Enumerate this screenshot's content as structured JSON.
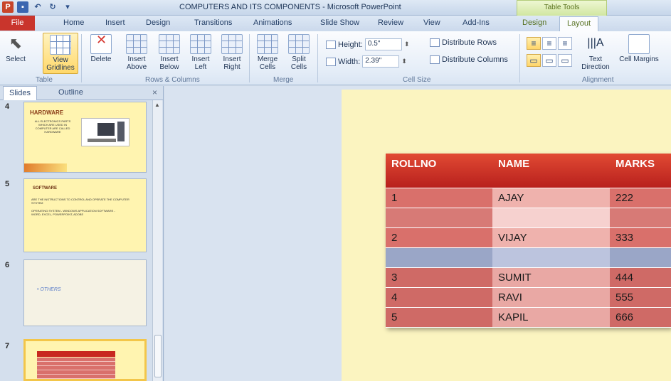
{
  "titlebar": {
    "title": "COMPUTERS AND ITS COMPONENTS  -  Microsoft PowerPoint",
    "contextual_group": "Table Tools"
  },
  "tabs": [
    {
      "label": "File"
    },
    {
      "label": "Home"
    },
    {
      "label": "Insert"
    },
    {
      "label": "Design"
    },
    {
      "label": "Transitions"
    },
    {
      "label": "Animations"
    },
    {
      "label": "Slide Show"
    },
    {
      "label": "Review"
    },
    {
      "label": "View"
    },
    {
      "label": "Add-Ins"
    },
    {
      "label": "Design"
    },
    {
      "label": "Layout"
    }
  ],
  "ribbon": {
    "table_group": {
      "label": "Table",
      "select": "Select",
      "view_gridlines": "View Gridlines"
    },
    "rows_columns": {
      "label": "Rows & Columns",
      "delete": "Delete",
      "insert_above": "Insert Above",
      "insert_below": "Insert Below",
      "insert_left": "Insert Left",
      "insert_right": "Insert Right"
    },
    "merge": {
      "label": "Merge",
      "merge_cells": "Merge Cells",
      "split_cells": "Split Cells"
    },
    "cell_size": {
      "label": "Cell Size",
      "height_label": "Height:",
      "height_value": "0.5\"",
      "width_label": "Width:",
      "width_value": "2.39\"",
      "distribute_rows": "Distribute Rows",
      "distribute_columns": "Distribute Columns"
    },
    "alignment": {
      "label": "Alignment",
      "text_direction": "Text Direction",
      "cell_margins": "Cell Margins"
    }
  },
  "slides_pane": {
    "tab_slides": "Slides",
    "tab_outline": "Outline",
    "close": "×",
    "thumbs": [
      {
        "num": "4",
        "title": "HARDWARE",
        "body": "ALL ELECTRONICS PARTS WHICH ARE USED IN COMPUTER ARE CALLED HARDWARE"
      },
      {
        "num": "5",
        "title": "SOFTWARE",
        "body": "ARE THE INSTRUCTIONS TO CONTROL AND OPERATE THE COMPUTER SYSTEM",
        "body2": "OPERATING SYSTEM - WINDOWS  APPLICATION SOFTWARE - WORD, EXCEL, POWERPOINT, ADOBE"
      },
      {
        "num": "6",
        "title": "",
        "body": "• OTHERS"
      },
      {
        "num": "7",
        "title": "",
        "body": ""
      }
    ]
  },
  "table": {
    "headers": [
      "ROLLNO",
      "NAME",
      "MARKS"
    ],
    "rows": [
      {
        "rollno": "1",
        "name": "AJAY",
        "marks": "222"
      },
      {
        "rollno": "",
        "name": "",
        "marks": ""
      },
      {
        "rollno": "2",
        "name": "VIJAY",
        "marks": "333"
      },
      {
        "rollno": "",
        "name": "",
        "marks": ""
      },
      {
        "rollno": "3",
        "name": "SUMIT",
        "marks": "444"
      },
      {
        "rollno": "4",
        "name": "RAVI",
        "marks": "555"
      },
      {
        "rollno": "5",
        "name": "KAPIL",
        "marks": "666"
      }
    ]
  },
  "colors": {
    "header_red": "#c8281f",
    "row_red": "#d9706b",
    "row_blue": "#9aa6c7",
    "slide_bg": "#fbf4c0",
    "file_tab": "#c9352c"
  }
}
